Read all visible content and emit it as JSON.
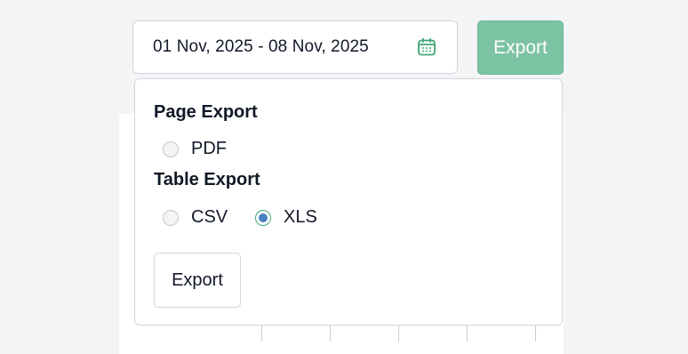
{
  "date_range": {
    "value": "01 Nov, 2025 - 08 Nov, 2025",
    "icon": "calendar-icon"
  },
  "toolbar": {
    "export_label": "Export"
  },
  "export_menu": {
    "page_export_title": "Page Export",
    "page_options": [
      {
        "label": "PDF",
        "checked": false
      }
    ],
    "table_export_title": "Table Export",
    "table_options": [
      {
        "label": "CSV",
        "checked": false
      },
      {
        "label": "XLS",
        "checked": true
      }
    ],
    "submit_label": "Export"
  },
  "colors": {
    "accent": "#7cc3a4",
    "radio_checked_ring": "#3ea776",
    "radio_checked_dot": "#4a7fc1"
  }
}
